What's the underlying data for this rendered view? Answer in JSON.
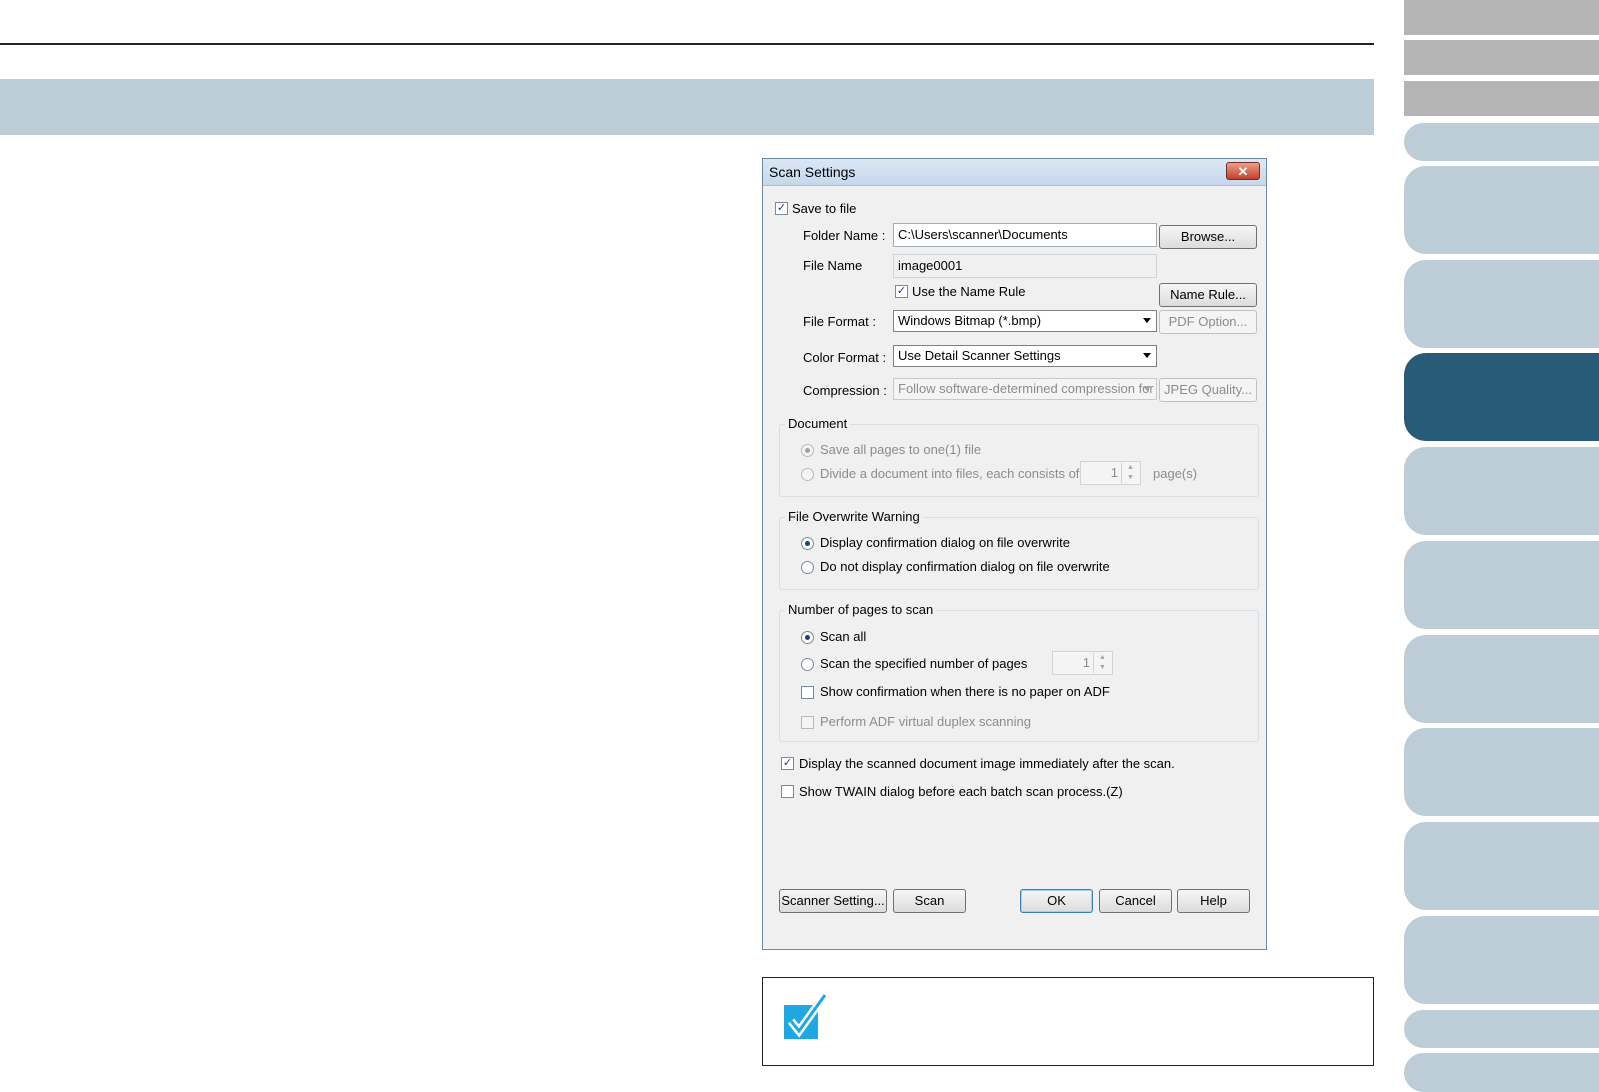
{
  "colors": {
    "header_band": "#bccdd7",
    "side_tab": "#bccdd7",
    "side_tab_active": "#285b78",
    "side_tab_grey": "#b4b4b4",
    "check_icon": "#1ea7e0"
  },
  "dialog": {
    "title": "Scan Settings",
    "close_glyph": "✕",
    "save_to_file": {
      "label": "Save to file",
      "checked": true
    },
    "folder_name": {
      "label": "Folder Name :",
      "value": "C:\\Users\\scanner\\Documents",
      "button": "Browse..."
    },
    "file_name": {
      "label": "File Name",
      "value": "image0001"
    },
    "name_rule": {
      "label": "Use the Name Rule",
      "checked": true,
      "button": "Name Rule..."
    },
    "file_format": {
      "label": "File Format :",
      "value": "Windows Bitmap (*.bmp)",
      "button": "PDF Option..."
    },
    "color_format": {
      "label": "Color Format :",
      "value": "Use Detail Scanner Settings"
    },
    "compression": {
      "label": "Compression :",
      "value": "Follow software-determined compression for",
      "button": "JPEG Quality..."
    },
    "document_group": {
      "label": "Document",
      "option_one": "Save all pages to one(1) file",
      "option_divide": "Divide a document into files, each consists of",
      "pages_value": "1",
      "pages_unit": "page(s)"
    },
    "overwrite_group": {
      "label": "File Overwrite Warning",
      "option_display": "Display confirmation dialog on file overwrite",
      "option_no_display": "Do not display confirmation dialog on file overwrite"
    },
    "pages_group": {
      "label": "Number of pages to scan",
      "option_all": "Scan all",
      "option_specified": "Scan the specified number of pages",
      "specified_value": "1",
      "show_confirmation": "Show confirmation when there is no paper on ADF",
      "virtual_duplex": "Perform ADF virtual duplex scanning"
    },
    "display_image": {
      "label": "Display the scanned document image immediately after the scan.",
      "checked": true
    },
    "show_twain": {
      "label": "Show TWAIN dialog before each batch scan process.(Z)",
      "checked": false
    },
    "buttons": {
      "scanner_setting": "Scanner Setting...",
      "scan": "Scan",
      "ok": "OK",
      "cancel": "Cancel",
      "help": "Help"
    }
  },
  "note": {
    "icon": "check-mark-icon"
  }
}
